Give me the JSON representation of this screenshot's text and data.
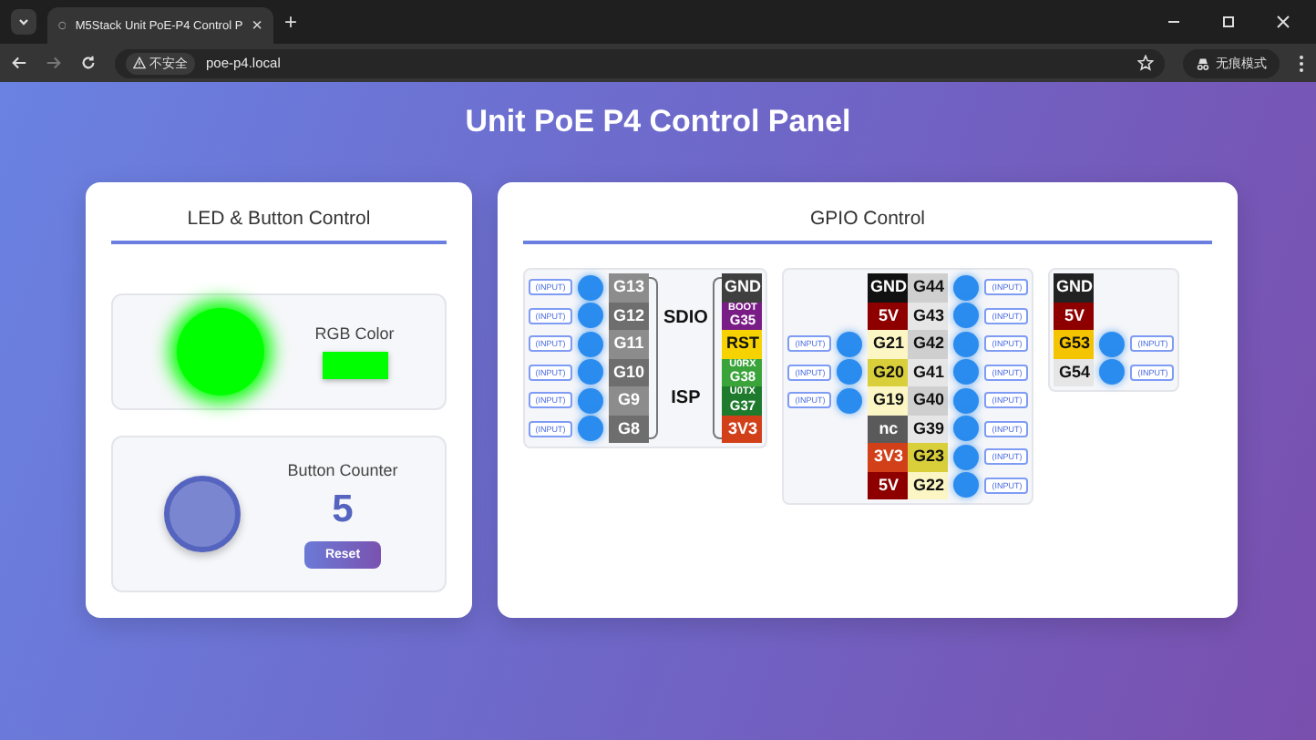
{
  "browser": {
    "tab_title": "M5Stack Unit PoE-P4 Control P",
    "tab_close": "×",
    "new_tab": "+",
    "security": "不安全",
    "url": "poe-p4.local",
    "profile": "无痕模式"
  },
  "title": "Unit PoE P4 Control Panel",
  "led_card": {
    "title": "LED & Button Control",
    "led": {
      "color": "#00ff00",
      "label": "RGB Color"
    },
    "counter": {
      "label": "Button Counter",
      "value": "5",
      "reset": "Reset"
    }
  },
  "gpio": {
    "title": "GPIO Control",
    "section1": {
      "pins": [
        {
          "label": "G13",
          "color": "#8c8c8c",
          "io": "(INPUT)"
        },
        {
          "label": "G12",
          "color": "#6e6e6e",
          "io": "(INPUT)"
        },
        {
          "label": "G11",
          "color": "#8c8c8c",
          "io": "(INPUT)"
        },
        {
          "label": "G10",
          "color": "#6e6e6e",
          "io": "(INPUT)"
        },
        {
          "label": "G9",
          "color": "#8c8c8c",
          "io": "(INPUT)"
        },
        {
          "label": "G8",
          "color": "#6e6e6e",
          "io": "(INPUT)"
        }
      ],
      "groups": [
        "SDIO",
        "ISP"
      ],
      "headers": [
        {
          "label": "GND",
          "color": "#3f3f3f"
        },
        {
          "top": "BOOT",
          "label": "G35",
          "color": "#7a1c86"
        },
        {
          "label": "RST",
          "color": "#f6d300"
        },
        {
          "top": "U0RX",
          "label": "G38",
          "color": "#3aa43a"
        },
        {
          "top": "U0TX",
          "label": "G37",
          "color": "#1e7a2c"
        },
        {
          "label": "3V3",
          "color": "#d2401a"
        }
      ]
    },
    "section2": {
      "rows": [
        {
          "left": {
            "label": "GND",
            "color": "#111111"
          },
          "right": {
            "label": "G44",
            "color": "#cfcfcf"
          },
          "right_io": "(INPUT)"
        },
        {
          "left": {
            "label": "5V",
            "color": "#8e0000"
          },
          "right": {
            "label": "G43",
            "color": "#e6e6e6"
          },
          "right_io": "(INPUT)"
        },
        {
          "left_io": "(INPUT)",
          "left": {
            "label": "G21",
            "color": "#fbf6c4"
          },
          "right": {
            "label": "G42",
            "color": "#cfcfcf"
          },
          "right_io": "(INPUT)"
        },
        {
          "left_io": "(INPUT)",
          "left": {
            "label": "G20",
            "color": "#d8cf3a"
          },
          "right": {
            "label": "G41",
            "color": "#e6e6e6"
          },
          "right_io": "(INPUT)"
        },
        {
          "left_io": "(INPUT)",
          "left": {
            "label": "G19",
            "color": "#fbf6c4"
          },
          "right": {
            "label": "G40",
            "color": "#cfcfcf"
          },
          "right_io": "(INPUT)"
        },
        {
          "left": {
            "label": "nc",
            "color": "#5a5a5a"
          },
          "right": {
            "label": "G39",
            "color": "#e6e6e6"
          },
          "right_io": "(INPUT)"
        },
        {
          "left": {
            "label": "3V3",
            "color": "#d2401a"
          },
          "right": {
            "label": "G23",
            "color": "#d8cf3a"
          },
          "right_io": "(INPUT)"
        },
        {
          "left": {
            "label": "5V",
            "color": "#8e0000"
          },
          "right": {
            "label": "G22",
            "color": "#fbf6c4"
          },
          "right_io": "(INPUT)"
        }
      ]
    },
    "section3": {
      "rows": [
        {
          "pin": {
            "label": "GND",
            "color": "#222222"
          }
        },
        {
          "pin": {
            "label": "5V",
            "color": "#8e0000"
          }
        },
        {
          "pin": {
            "label": "G53",
            "color": "#f5c400"
          },
          "io": "(INPUT)"
        },
        {
          "pin": {
            "label": "G54",
            "color": "#e6e6e6"
          },
          "io": "(INPUT)"
        }
      ]
    }
  }
}
